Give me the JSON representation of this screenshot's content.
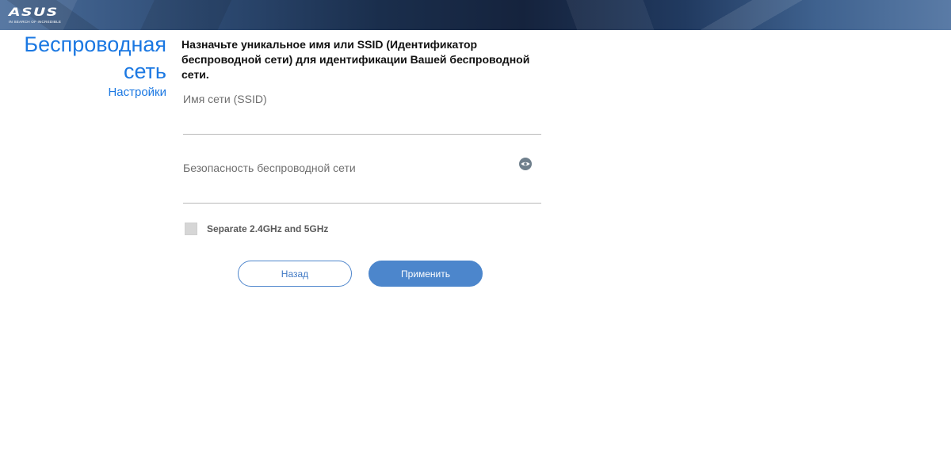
{
  "header": {
    "logo_text": "ASUS",
    "logo_tagline": "IN SEARCH OF INCREDIBLE"
  },
  "sidebar": {
    "title_line1": "Беспроводная",
    "title_line2": "сеть",
    "subtitle": "Настройки"
  },
  "main": {
    "headline": "Назначьте уникальное имя или SSID (Идентификатор беспроводной сети) для идентификации Вашей беспроводной сети.",
    "ssid": {
      "label": "Имя сети (SSID)",
      "value": ""
    },
    "security": {
      "label": "Безопасность беспроводной сети",
      "value": "",
      "icon": "eye-icon"
    },
    "separate_bands": {
      "label": "Separate 2.4GHz and 5GHz",
      "checked": false
    },
    "buttons": {
      "back_label": "Назад",
      "apply_label": "Применить"
    }
  },
  "colors": {
    "accent": "#1b78e2",
    "button_primary": "#4c86cc"
  }
}
